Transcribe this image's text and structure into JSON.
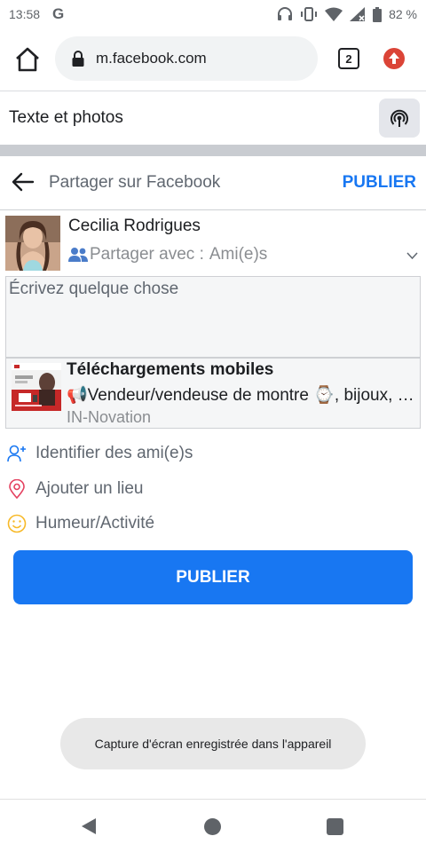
{
  "status_bar": {
    "time": "13:58",
    "app_indicator": "G",
    "battery_percent": "82 %",
    "icons": [
      "headphones-icon",
      "vibrate-icon",
      "wifi-icon",
      "signal-icon",
      "battery-icon"
    ]
  },
  "browser": {
    "url": "m.facebook.com",
    "tab_count": "2",
    "icons": [
      "home-icon",
      "lock-icon",
      "tabs-icon",
      "update-arrow-icon"
    ],
    "colors": {
      "update_badge": "#db4437",
      "url_bar_bg": "#f1f3f4"
    }
  },
  "text_photos": {
    "title": "Texte et photos",
    "icon": "broadcast-icon"
  },
  "share_header": {
    "title": "Partager sur Facebook",
    "publish_label": "PUBLIER",
    "icon": "back-arrow-icon"
  },
  "composer": {
    "user_name": "Cecilia Rodrigues",
    "audience_prefix": "Partager avec : ",
    "audience_value": "Ami(e)s",
    "placeholder": "Écrivez quelque chose",
    "icons": [
      "friends-icon",
      "caret-down-icon"
    ]
  },
  "link_preview": {
    "title": "Téléchargements mobiles",
    "description": "📢Vendeur/vendeuse de montre ⌚, bijoux, parfums et accessoires",
    "source": "IN-Novation"
  },
  "actions": [
    {
      "label": "Identifier des ami(e)s",
      "icon": "tag-friend-icon",
      "color": "#1877f2"
    },
    {
      "label": "Ajouter un lieu",
      "icon": "location-pin-icon",
      "color": "#e4405f"
    },
    {
      "label": "Humeur/Activité",
      "icon": "smiley-icon",
      "color": "#f7b928"
    }
  ],
  "publish_button": {
    "label": "PUBLIER",
    "color": "#1877f2"
  },
  "toast": {
    "message": "Capture d'écran enregistrée dans l'appareil"
  },
  "nav": {
    "icons": [
      "nav-back-icon",
      "nav-home-icon",
      "nav-recents-icon"
    ]
  }
}
